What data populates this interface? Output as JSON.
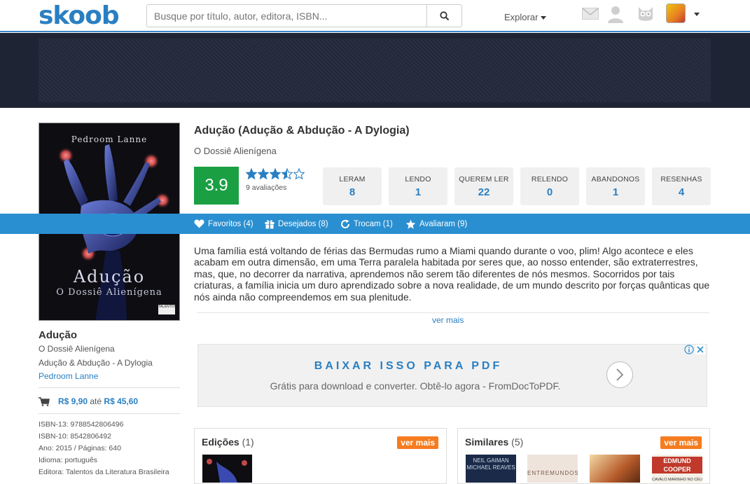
{
  "header": {
    "logo": "skoob",
    "search_placeholder": "Busque por título, autor, editora, ISBN...",
    "explore_label": "Explorar"
  },
  "book": {
    "title": "Adução (Adução & Abdução - A Dylogia)",
    "subtitle": "O Dossiê Alienígena",
    "rating": "3.9",
    "rating_stars": 3.5,
    "ratings_count": "9 avaliações",
    "synopsis": "Uma família está voltando de férias das Bermudas rumo a Miami quando durante o voo, plim! Algo acontece e eles acabam em outra dimensão, em uma Terra paralela habitada por seres que, ao nosso entender, são extraterrestres, mas, que, no decorrer da narrativa, aprendemos não serem tão diferentes de nós mesmos. Socorridos por tais criaturas, a família inicia um duro aprendizado sobre a nova realidade, de um mundo descrito por forças quânticas que nós ainda não compreendemos em sua plenitude.",
    "see_more": "ver mais"
  },
  "cover": {
    "author": "Pedroom Lanne",
    "title": "Adução",
    "subtitle": "O Dossiê Alienígena",
    "publisher_badge": "TALENTOS"
  },
  "stats": [
    {
      "label": "LERAM",
      "value": "8"
    },
    {
      "label": "LENDO",
      "value": "1"
    },
    {
      "label": "QUEREM LER",
      "value": "22"
    },
    {
      "label": "RELENDO",
      "value": "0"
    },
    {
      "label": "ABANDONOS",
      "value": "1"
    },
    {
      "label": "RESENHAS",
      "value": "4"
    }
  ],
  "tabs": [
    {
      "label": "Favoritos (4)"
    },
    {
      "label": "Desejados (8)"
    },
    {
      "label": "Trocam (1)"
    },
    {
      "label": "Avaliaram (9)"
    }
  ],
  "sidebar": {
    "title": "Adução",
    "subtitle": "O Dossiê Alienígena",
    "series": "Adução & Abdução - A Dylogia",
    "author": "Pedroom Lanne",
    "price_from": "R$ 9,90",
    "price_sep": "até",
    "price_to": "R$ 45,60",
    "meta": [
      "ISBN-13: 9788542806496",
      "ISBN-10: 8542806492",
      "Ano: 2015 / Páginas: 640",
      "Idioma: português",
      "Editora: Talentos da Literatura Brasileira"
    ]
  },
  "ad": {
    "headline": "BAIXAR ISSO PARA PDF",
    "description": "Grátis para download e converter. Obtê-lo agora - FromDocToPDF."
  },
  "panels": {
    "editions_title": "Edições",
    "editions_count": "(1)",
    "similar_title": "Similares",
    "similar_count": "(5)",
    "see_more": "ver mais",
    "similar_thumb_1_text": "NEIL GAIMAN MICHAEL REAVES",
    "similar_thumb_2_text": "ENTREMUNDOS",
    "similar_thumb_4_text": "EDMUND COOPER",
    "similar_thumb_4_sub": "CAVALO MARINHO NO CÉU"
  },
  "colors": {
    "brand": "#2a7fc2",
    "bar": "#2a8fd0",
    "score": "#1aa043",
    "badge": "#f57c1f"
  }
}
